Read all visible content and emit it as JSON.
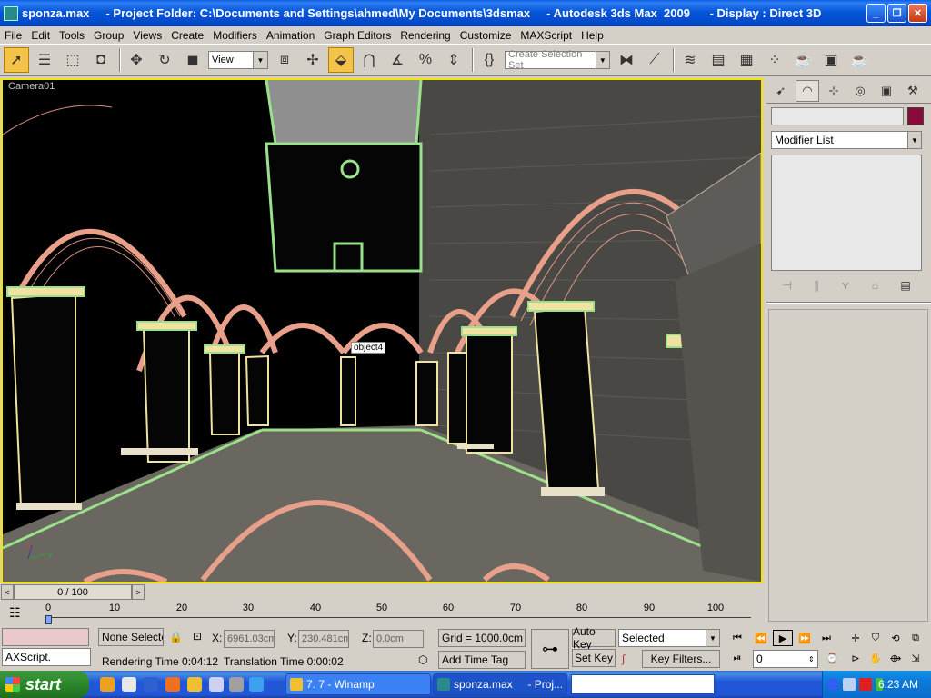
{
  "window": {
    "title": "sponza.max     - Project Folder: C:\\Documents and Settings\\ahmed\\My Documents\\3dsmax     - Autodesk 3ds Max  2009      - Display : Direct 3D",
    "minimize": "_",
    "maximize": "❐",
    "close": "✕"
  },
  "menu": [
    "File",
    "Edit",
    "Tools",
    "Group",
    "Views",
    "Create",
    "Modifiers",
    "Animation",
    "Graph Editors",
    "Rendering",
    "Customize",
    "MAXScript",
    "Help"
  ],
  "toolbar": {
    "reference_coord": "View",
    "selection_set_placeholder": "Create Selection Set"
  },
  "viewport": {
    "label": "Camera01",
    "tooltip": "object4",
    "axis_x": "x",
    "axis_y": "y"
  },
  "command_panel": {
    "modifier_list": "Modifier List"
  },
  "time_slider": {
    "position": "0 / 100",
    "left": "<",
    "right": ">"
  },
  "track_bar": {
    "ticks": [
      "0",
      "10",
      "20",
      "30",
      "40",
      "50",
      "60",
      "70",
      "80",
      "90",
      "100"
    ]
  },
  "status": {
    "maxscript": "AXScript.",
    "selection": "None Selecte",
    "x_label": "X:",
    "x_value": "6961.03cm",
    "y_label": "Y:",
    "y_value": "230.481cm",
    "z_label": "Z:",
    "z_value": "0.0cm",
    "grid": "Grid = 1000.0cm",
    "rendering_time": "Rendering Time  0:04:12",
    "translation_time": "Translation Time  0:00:02",
    "add_time_tag": "Add Time Tag",
    "auto_key": "Auto Key",
    "set_key": "Set Key",
    "key_mode": "Selected",
    "key_filters": "Key Filters...",
    "current_frame": "0"
  },
  "taskbar": {
    "start": "start",
    "tasks": [
      "7. 7 - Winamp",
      "sponza.max     - Proj..."
    ],
    "clock": "6:23 AM"
  }
}
